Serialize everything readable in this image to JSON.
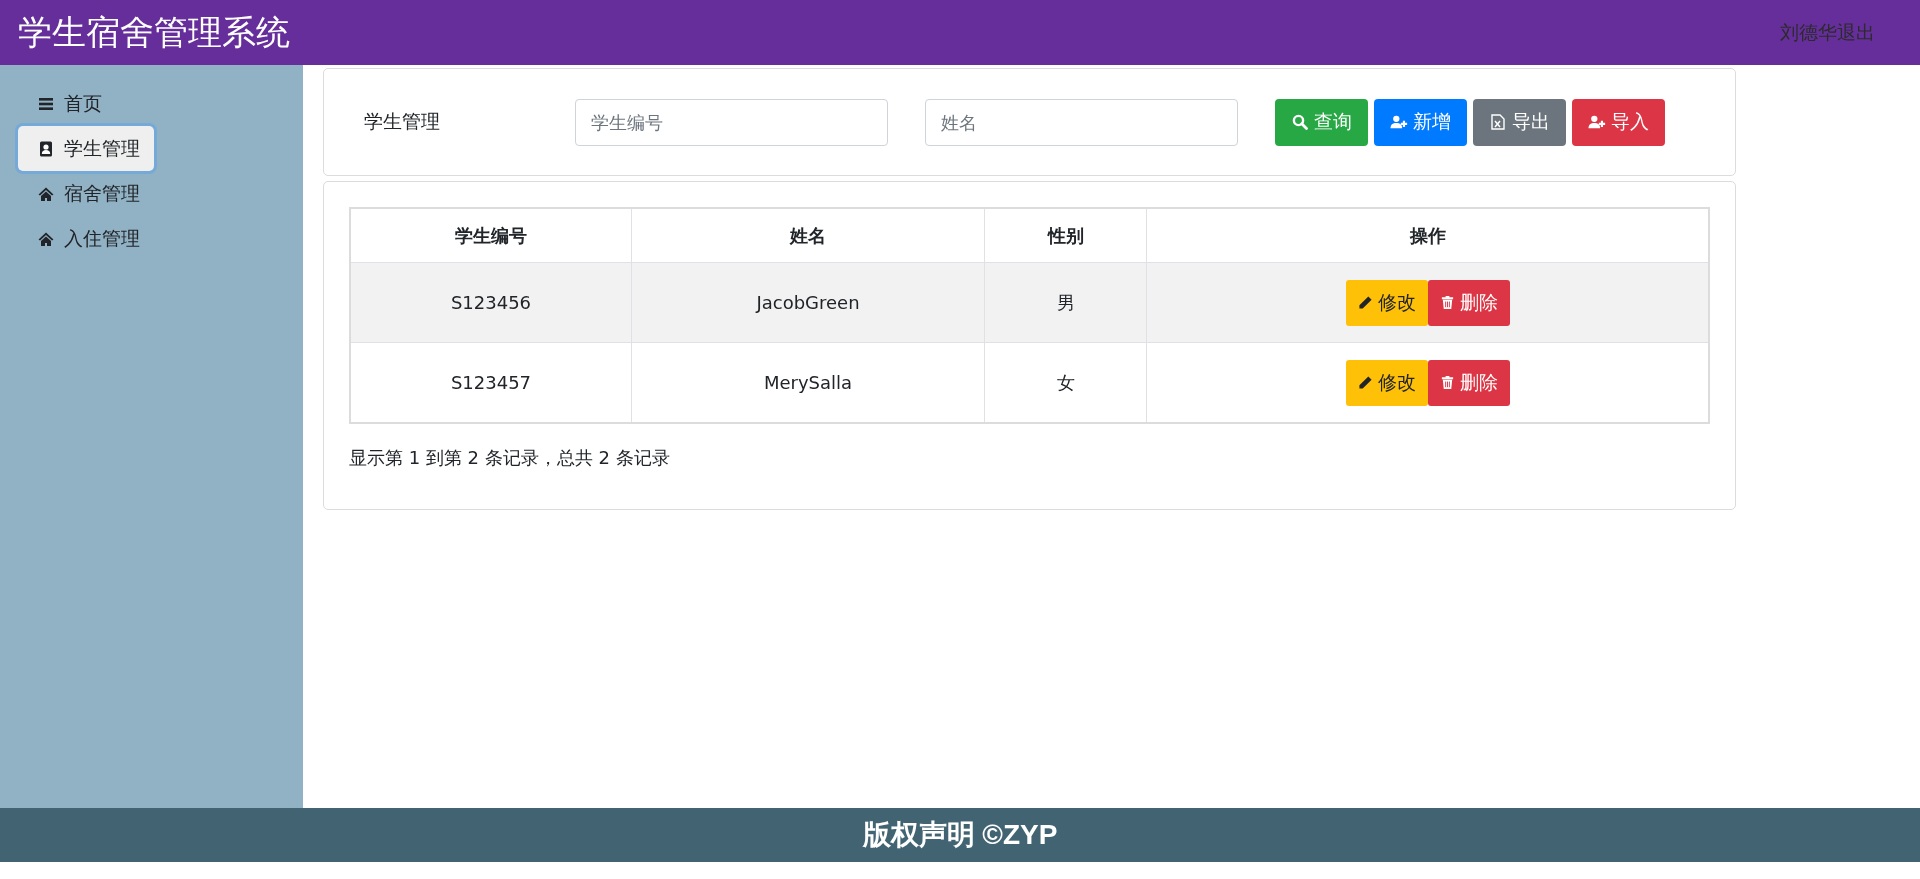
{
  "header": {
    "title": "学生宿舍管理系统",
    "user": "刘德华",
    "logout": "退出"
  },
  "sidebar": {
    "items": [
      {
        "label": "首页",
        "kind": "menu",
        "selected": false
      },
      {
        "label": "学生管理",
        "kind": "contact",
        "selected": true
      },
      {
        "label": "宿舍管理",
        "kind": "home",
        "selected": false
      },
      {
        "label": "入住管理",
        "kind": "home",
        "selected": false
      }
    ]
  },
  "toolbar": {
    "title": "学生管理",
    "fields": [
      {
        "placeholder": "学生编号"
      },
      {
        "placeholder": "姓名"
      }
    ],
    "buttons": [
      {
        "label": "查询",
        "kind": "search"
      },
      {
        "label": "新增",
        "kind": "add"
      },
      {
        "label": "导出",
        "kind": "export"
      },
      {
        "label": "导入",
        "kind": "import"
      }
    ]
  },
  "table": {
    "columns": [
      "学生编号",
      "姓名",
      "性别",
      "操作"
    ],
    "rows": [
      {
        "cells": [
          "S123456",
          "JacobGreen",
          "男"
        ],
        "actions": [
          "修改",
          "删除"
        ]
      },
      {
        "cells": [
          "S123457",
          "MerySalla",
          "女"
        ],
        "actions": [
          "修改",
          "删除"
        ]
      }
    ]
  },
  "pagination": "显示第 1 到第 2 条记录，总共 2 条记录",
  "footer": "版权声明 ©ZYP"
}
